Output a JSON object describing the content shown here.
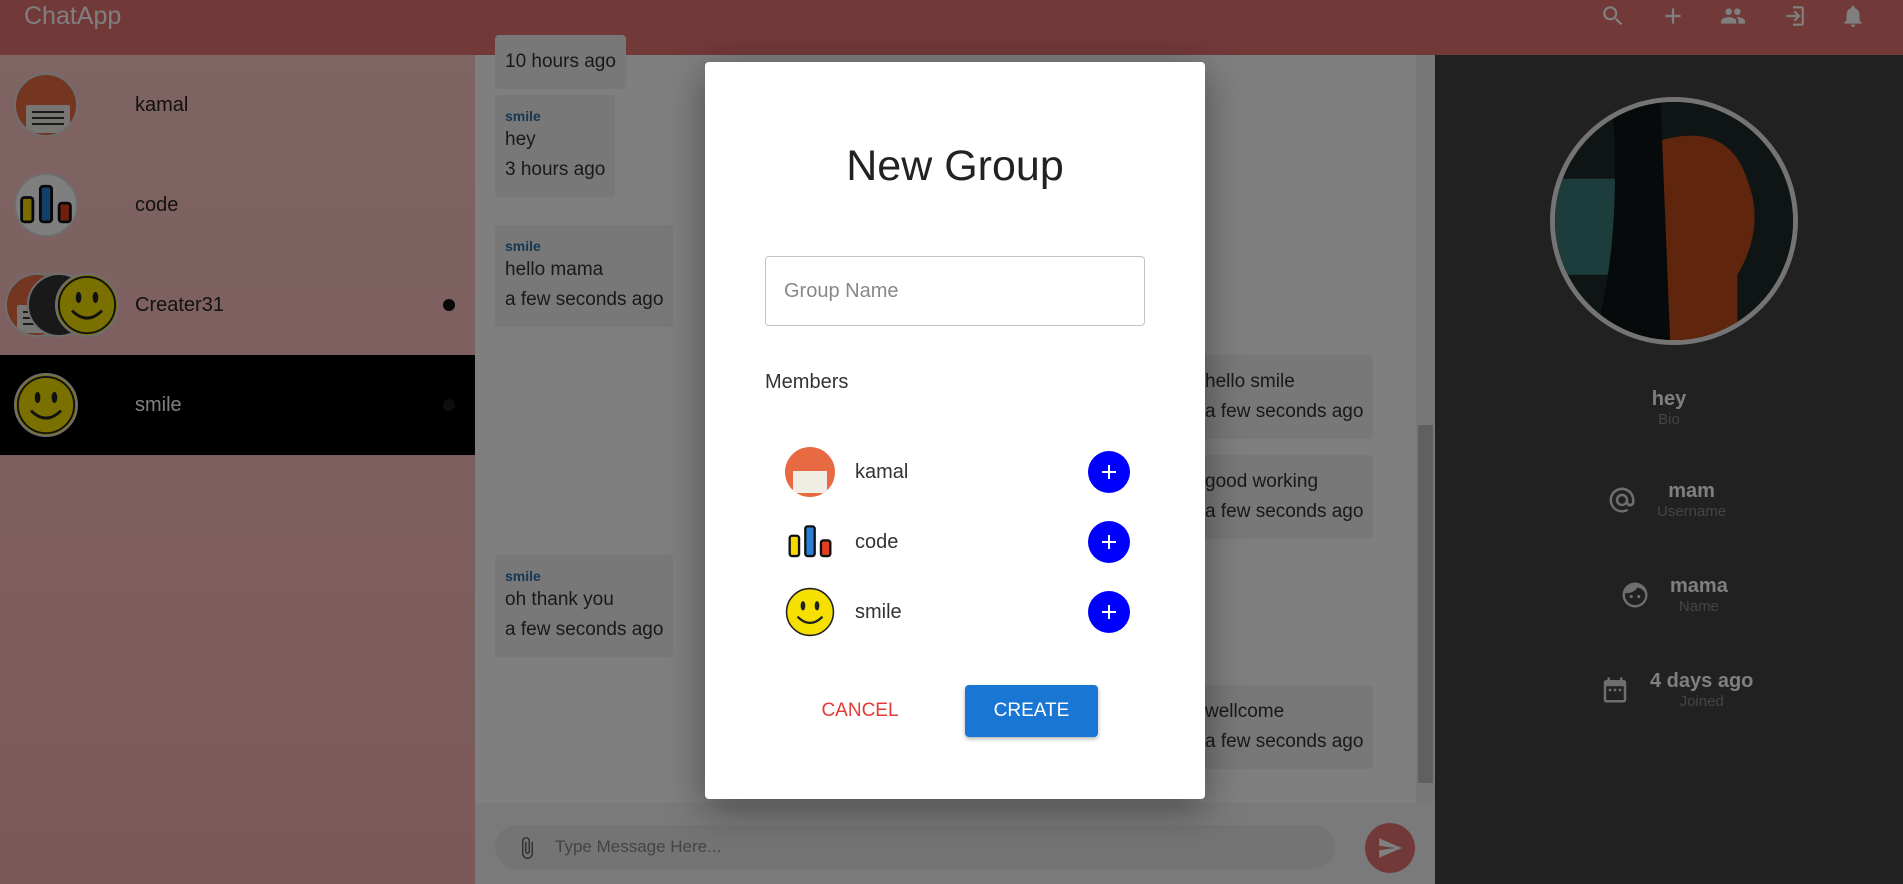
{
  "app": {
    "title": "ChatApp"
  },
  "toolbar": {
    "icons": [
      "search-icon",
      "add-icon",
      "group-icon",
      "logout-icon",
      "notifications-icon"
    ]
  },
  "sidebar": {
    "items": [
      {
        "name": "kamal",
        "avatar": "kamal"
      },
      {
        "name": "code",
        "avatar": "code"
      },
      {
        "name": "Creater31",
        "avatar": "group",
        "unread": true
      },
      {
        "name": "smile",
        "avatar": "smile",
        "selected": true,
        "unread": true
      }
    ]
  },
  "messages": [
    {
      "sender": "",
      "text": "",
      "time": "10 hours ago"
    },
    {
      "sender": "smile",
      "text": "hey",
      "time": "3 hours ago"
    },
    {
      "sender": "smile",
      "text": "hello mama",
      "time": "a few seconds ago"
    },
    {
      "sender": "",
      "text": "hello smile",
      "time": "a few seconds ago"
    },
    {
      "sender": "",
      "text": "good working",
      "time": "a few seconds ago"
    },
    {
      "sender": "smile",
      "text": "oh thank you",
      "time": "a few seconds ago"
    },
    {
      "sender": "",
      "text": "wellcome",
      "time": "a few seconds ago"
    }
  ],
  "composer": {
    "placeholder": "Type Message Here..."
  },
  "profile": {
    "bio_value": "hey",
    "bio_label": "Bio",
    "username_value": "mam",
    "username_label": "Username",
    "name_value": "mama",
    "name_label": "Name",
    "joined_value": "4 days ago",
    "joined_label": "Joined"
  },
  "dialog": {
    "title": "New Group",
    "group_name_placeholder": "Group Name",
    "members_label": "Members",
    "members": [
      {
        "name": "kamal"
      },
      {
        "name": "code"
      },
      {
        "name": "smile"
      }
    ],
    "cancel_label": "CANCEL",
    "create_label": "CREATE"
  },
  "colors": {
    "appbar": "#e57373",
    "sidebar": "#ffc8c8",
    "add_button": "#0000ff",
    "create_button": "#1976d2",
    "cancel_text": "#e53935",
    "sender_name": "#2b6fa6"
  }
}
